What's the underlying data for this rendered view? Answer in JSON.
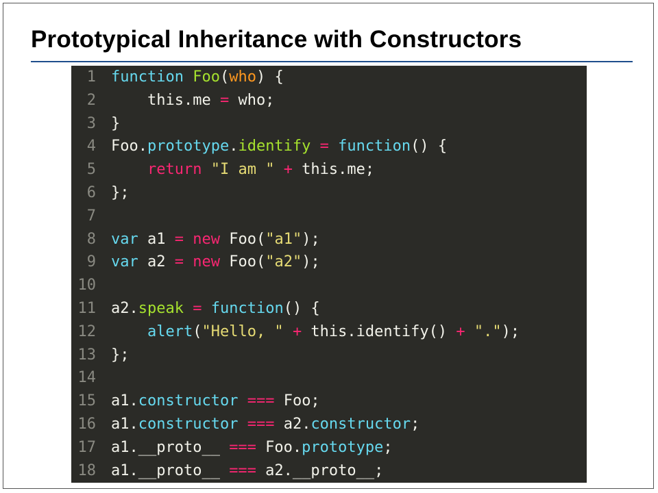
{
  "slide": {
    "title": "Prototypical Inheritance with Constructors"
  },
  "colors": {
    "title_rule": "#1f4e8c",
    "code_background": "#2b2b27",
    "line_number": "#8a8a82",
    "plain_text": "#f2f2ea",
    "keyword": "#66d9ef",
    "function_name": "#a6e22e",
    "param": "#fd971f",
    "operator": "#f92672",
    "string": "#e6db74"
  },
  "code": {
    "language": "javascript",
    "lines": [
      {
        "number": "1",
        "tokens": [
          {
            "t": "function",
            "c": "keyword"
          },
          {
            "t": " ",
            "c": "plain"
          },
          {
            "t": "Foo",
            "c": "function-name"
          },
          {
            "t": "(",
            "c": "plain"
          },
          {
            "t": "who",
            "c": "param"
          },
          {
            "t": ") {",
            "c": "plain"
          }
        ]
      },
      {
        "number": "2",
        "tokens": [
          {
            "t": "    this.me ",
            "c": "plain"
          },
          {
            "t": "=",
            "c": "operator"
          },
          {
            "t": " who;",
            "c": "plain"
          }
        ]
      },
      {
        "number": "3",
        "tokens": [
          {
            "t": "}",
            "c": "plain"
          }
        ]
      },
      {
        "number": "4",
        "tokens": [
          {
            "t": "Foo.",
            "c": "plain"
          },
          {
            "t": "prototype",
            "c": "keyword"
          },
          {
            "t": ".",
            "c": "plain"
          },
          {
            "t": "identify",
            "c": "function-name"
          },
          {
            "t": " ",
            "c": "plain"
          },
          {
            "t": "=",
            "c": "operator"
          },
          {
            "t": " ",
            "c": "plain"
          },
          {
            "t": "function",
            "c": "keyword"
          },
          {
            "t": "() {",
            "c": "plain"
          }
        ]
      },
      {
        "number": "5",
        "tokens": [
          {
            "t": "    ",
            "c": "plain"
          },
          {
            "t": "return",
            "c": "operator"
          },
          {
            "t": " ",
            "c": "plain"
          },
          {
            "t": "\"I am \"",
            "c": "string"
          },
          {
            "t": " ",
            "c": "plain"
          },
          {
            "t": "+",
            "c": "operator"
          },
          {
            "t": " this.me;",
            "c": "plain"
          }
        ]
      },
      {
        "number": "6",
        "tokens": [
          {
            "t": "};",
            "c": "plain"
          }
        ]
      },
      {
        "number": "7",
        "tokens": []
      },
      {
        "number": "8",
        "tokens": [
          {
            "t": "var",
            "c": "keyword"
          },
          {
            "t": " a1 ",
            "c": "plain"
          },
          {
            "t": "=",
            "c": "operator"
          },
          {
            "t": " ",
            "c": "plain"
          },
          {
            "t": "new",
            "c": "operator"
          },
          {
            "t": " Foo(",
            "c": "plain"
          },
          {
            "t": "\"a1\"",
            "c": "string"
          },
          {
            "t": ");",
            "c": "plain"
          }
        ]
      },
      {
        "number": "9",
        "tokens": [
          {
            "t": "var",
            "c": "keyword"
          },
          {
            "t": " a2 ",
            "c": "plain"
          },
          {
            "t": "=",
            "c": "operator"
          },
          {
            "t": " ",
            "c": "plain"
          },
          {
            "t": "new",
            "c": "operator"
          },
          {
            "t": " Foo(",
            "c": "plain"
          },
          {
            "t": "\"a2\"",
            "c": "string"
          },
          {
            "t": ");",
            "c": "plain"
          }
        ]
      },
      {
        "number": "10",
        "tokens": []
      },
      {
        "number": "11",
        "tokens": [
          {
            "t": "a2.",
            "c": "plain"
          },
          {
            "t": "speak",
            "c": "function-name"
          },
          {
            "t": " ",
            "c": "plain"
          },
          {
            "t": "=",
            "c": "operator"
          },
          {
            "t": " ",
            "c": "plain"
          },
          {
            "t": "function",
            "c": "keyword"
          },
          {
            "t": "() {",
            "c": "plain"
          }
        ]
      },
      {
        "number": "12",
        "tokens": [
          {
            "t": "    ",
            "c": "plain"
          },
          {
            "t": "alert",
            "c": "keyword"
          },
          {
            "t": "(",
            "c": "plain"
          },
          {
            "t": "\"Hello, \"",
            "c": "string"
          },
          {
            "t": " ",
            "c": "plain"
          },
          {
            "t": "+",
            "c": "operator"
          },
          {
            "t": " this.identify() ",
            "c": "plain"
          },
          {
            "t": "+",
            "c": "operator"
          },
          {
            "t": " ",
            "c": "plain"
          },
          {
            "t": "\".\"",
            "c": "string"
          },
          {
            "t": ");",
            "c": "plain"
          }
        ]
      },
      {
        "number": "13",
        "tokens": [
          {
            "t": "};",
            "c": "plain"
          }
        ]
      },
      {
        "number": "14",
        "tokens": []
      },
      {
        "number": "15",
        "tokens": [
          {
            "t": "a1.",
            "c": "plain"
          },
          {
            "t": "constructor",
            "c": "keyword"
          },
          {
            "t": " ",
            "c": "plain"
          },
          {
            "t": "===",
            "c": "operator"
          },
          {
            "t": " Foo;",
            "c": "plain"
          }
        ]
      },
      {
        "number": "16",
        "tokens": [
          {
            "t": "a1.",
            "c": "plain"
          },
          {
            "t": "constructor",
            "c": "keyword"
          },
          {
            "t": " ",
            "c": "plain"
          },
          {
            "t": "===",
            "c": "operator"
          },
          {
            "t": " a2.",
            "c": "plain"
          },
          {
            "t": "constructor",
            "c": "keyword"
          },
          {
            "t": ";",
            "c": "plain"
          }
        ]
      },
      {
        "number": "17",
        "tokens": [
          {
            "t": "a1.__proto__ ",
            "c": "plain"
          },
          {
            "t": "===",
            "c": "operator"
          },
          {
            "t": " Foo.",
            "c": "plain"
          },
          {
            "t": "prototype",
            "c": "keyword"
          },
          {
            "t": ";",
            "c": "plain"
          }
        ]
      },
      {
        "number": "18",
        "tokens": [
          {
            "t": "a1.__proto__ ",
            "c": "plain"
          },
          {
            "t": "===",
            "c": "operator"
          },
          {
            "t": " a2.__proto__;",
            "c": "plain"
          }
        ]
      }
    ]
  }
}
